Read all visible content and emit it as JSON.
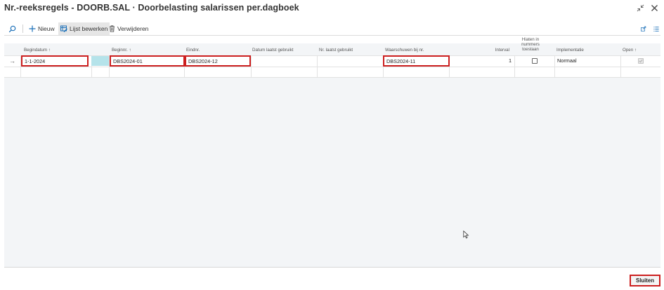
{
  "window": {
    "title": "Nr.-reeksregels - DOORB.SAL · Doorbelasting salarissen per.dagboek",
    "collapse_icon": "collapse-arrows-icon",
    "close_icon": "close-icon"
  },
  "toolbar": {
    "search_icon": "search-icon",
    "new_label": "Nieuw",
    "edit_list_label": "Lijst bewerken",
    "delete_label": "Verwijderen",
    "share_icon": "share-icon",
    "list_view_icon": "list-view-icon"
  },
  "columns": {
    "start_date": "Begindatum",
    "start_no": "Beginnr.",
    "end_no": "Eindnr.",
    "last_date_used": "Datum laatst gebruikt",
    "last_no_used": "Nr. laatst gebruikt",
    "warning_no": "Waarschuwen bij nr.",
    "interval": "Interval",
    "allow_gaps_1": "Hiaten in",
    "allow_gaps_2": "nummers",
    "allow_gaps_3": "toestaan",
    "implementation": "Implementatie",
    "open": "Open",
    "sort_arrow": "↑"
  },
  "rows": [
    {
      "start_date": "1-1-2024",
      "start_no": "DBS2024-01",
      "end_no": "DBS2024-12",
      "last_date_used": "",
      "last_no_used": "",
      "warning_no": "DBS2024-11",
      "interval": "1",
      "allow_gaps": false,
      "implementation": "Normaal",
      "open": true
    }
  ],
  "footer": {
    "close_label": "Sluiten"
  },
  "colors": {
    "highlight": "#cc1f1f",
    "selected_cell": "#b5e3ea",
    "grid_background": "#f3f5f7"
  }
}
